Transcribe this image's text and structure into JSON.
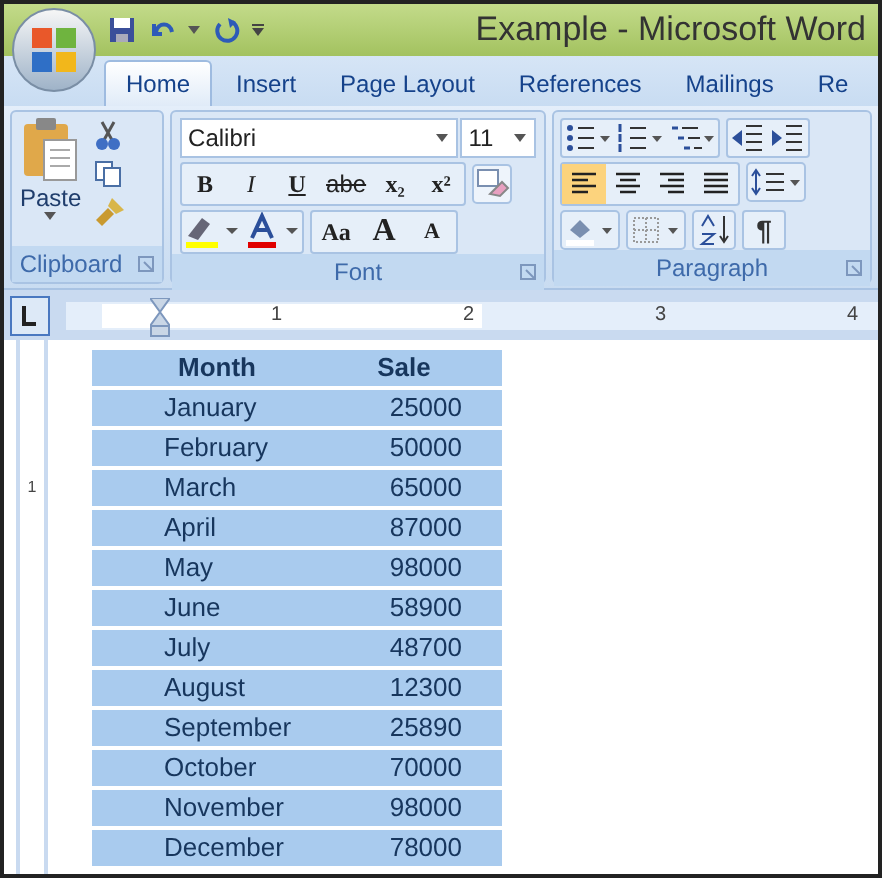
{
  "window": {
    "title": "Example - Microsoft Word"
  },
  "tabs": [
    {
      "label": "Home",
      "selected": true
    },
    {
      "label": "Insert",
      "selected": false
    },
    {
      "label": "Page Layout",
      "selected": false
    },
    {
      "label": "References",
      "selected": false
    },
    {
      "label": "Mailings",
      "selected": false
    },
    {
      "label": "Re",
      "selected": false
    }
  ],
  "clipboard": {
    "paste": "Paste",
    "label": "Clipboard"
  },
  "font": {
    "name": "Calibri",
    "size": "11",
    "label": "Font",
    "format_buttons": [
      {
        "label": "B",
        "kind": "bold"
      },
      {
        "label": "I",
        "kind": "italic"
      },
      {
        "label": "U",
        "kind": "underline"
      },
      {
        "label": "abe",
        "kind": "strike"
      },
      {
        "label": "x₂",
        "kind": "plain"
      },
      {
        "label": "x²",
        "kind": "plain"
      }
    ],
    "size_buttons": [
      {
        "label": "Aa",
        "kind": "menu"
      },
      {
        "label": "A",
        "kind": "grow"
      },
      {
        "label": "A",
        "kind": "shrink"
      }
    ]
  },
  "paragraph": {
    "label": "Paragraph",
    "pilcrow": "¶",
    "alignment": [
      {
        "selected": true
      },
      {
        "selected": false
      },
      {
        "selected": false
      },
      {
        "selected": false
      }
    ]
  },
  "ruler": {
    "marks": [
      "1",
      "2",
      "3",
      "4"
    ],
    "vertical_mark": "1"
  },
  "table": {
    "columns": [
      "Month",
      "Sale"
    ],
    "rows": [
      [
        "January",
        "25000"
      ],
      [
        "February",
        "50000"
      ],
      [
        "March",
        "65000"
      ],
      [
        "April",
        "87000"
      ],
      [
        "May",
        "98000"
      ],
      [
        "June",
        "58900"
      ],
      [
        "July",
        "48700"
      ],
      [
        "August",
        "12300"
      ],
      [
        "September",
        "25890"
      ],
      [
        "October",
        "70000"
      ],
      [
        "November",
        "98000"
      ],
      [
        "December",
        "78000"
      ]
    ]
  }
}
